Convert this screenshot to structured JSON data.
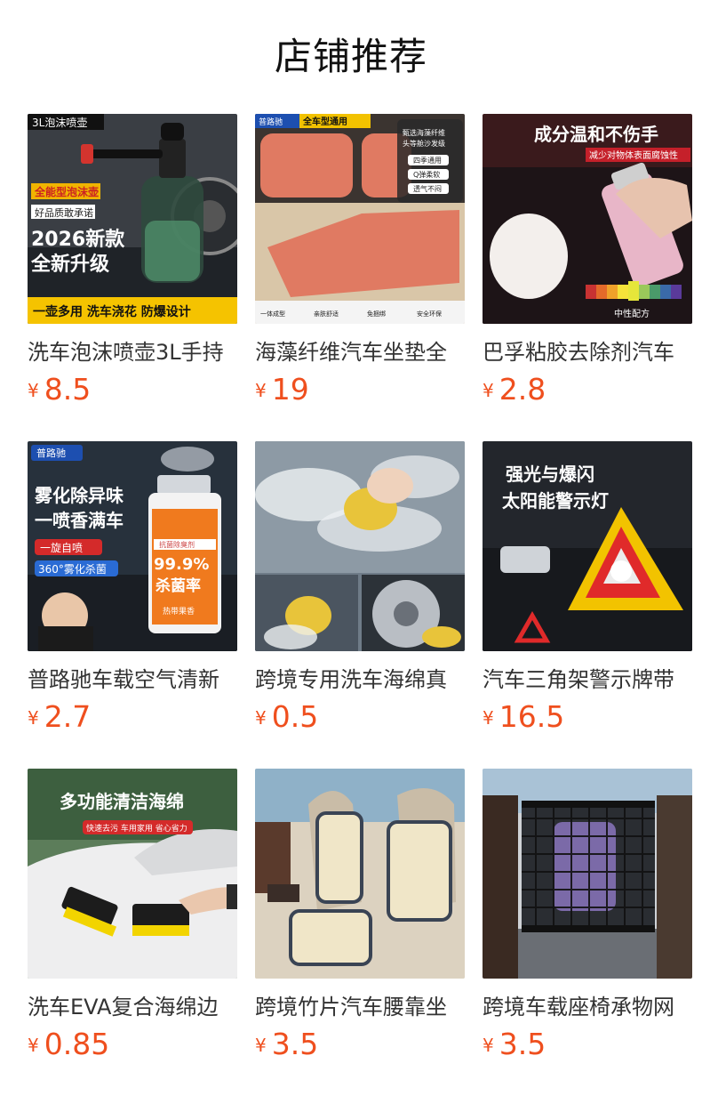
{
  "page": {
    "title": "店铺推荐"
  },
  "currency_symbol": "¥",
  "colors": {
    "price": "#ef4f1e"
  },
  "products": [
    {
      "name": "洗车泡沫喷壶3L手持",
      "price": "8.5",
      "image_text": [
        "3L泡沫喷壶",
        "全能型泡沫壶",
        "好品质敢承诺",
        "2026新款",
        "全新升级",
        "一壶多用 洗车浇花 防爆设计"
      ]
    },
    {
      "name": "海藻纤维汽车坐垫全",
      "price": "19",
      "image_text": [
        "普路驰",
        "全车型通用",
        "甄选海藻纤维",
        "头等舱沙发级",
        "四季通用",
        "Q弹柔软",
        "透气不闷",
        "一体成型",
        "亲肤舒适",
        "免捆绑",
        "安全环保"
      ]
    },
    {
      "name": "巴孚粘胶去除剂汽车",
      "price": "2.8",
      "image_text": [
        "成分温和不伤手",
        "减少对物体表面腐蚀性",
        "中性配方"
      ]
    },
    {
      "name": "普路驰车载空气清新",
      "price": "2.7",
      "image_text": [
        "普路驰",
        "雾化除异味",
        "一喷香满车",
        "一旋自喷",
        "360°雾化杀菌",
        "抗菌除臭剂",
        "99.9%",
        "杀菌率",
        "热带果香"
      ]
    },
    {
      "name": "跨境专用洗车海绵真",
      "price": "0.5",
      "image_text": []
    },
    {
      "name": "汽车三角架警示牌带",
      "price": "16.5",
      "image_text": [
        "强光与爆闪",
        "太阳能警示灯"
      ]
    },
    {
      "name": "洗车EVA复合海绵边",
      "price": "0.85",
      "image_text": [
        "多功能清洁海绵",
        "快速去污 车用家用 省心省力"
      ]
    },
    {
      "name": "跨境竹片汽车腰靠坐",
      "price": "3.5",
      "image_text": []
    },
    {
      "name": "跨境车载座椅承物网",
      "price": "3.5",
      "image_text": []
    }
  ]
}
